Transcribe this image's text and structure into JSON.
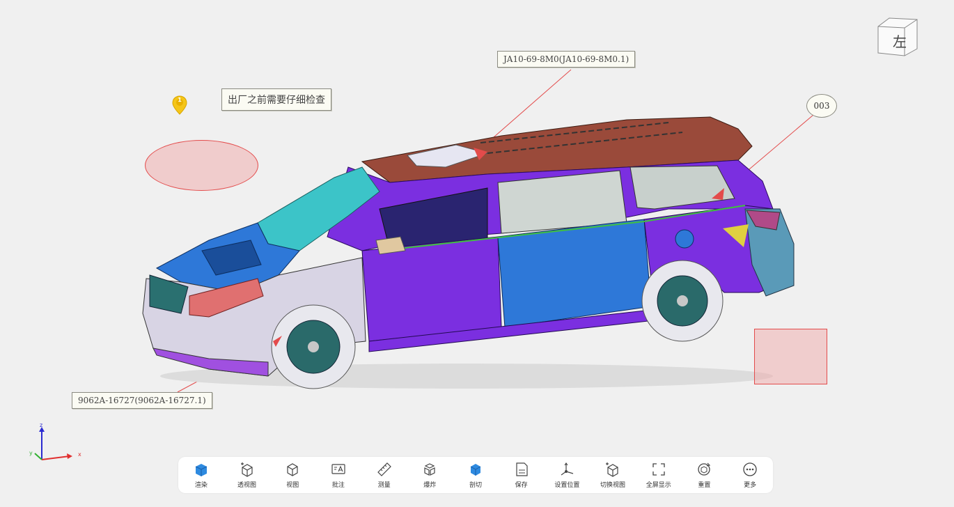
{
  "annotations": {
    "note_pin_number": "1",
    "note_text": "出厂之前需要仔细检查",
    "part_label_roof": "JA10-69-8M0(JA10-69-8M0.1)",
    "part_label_bumper": "9062A-16727(9062A-16727.1)",
    "circle_tag": "003"
  },
  "view_cube": {
    "face_label": "左"
  },
  "axes": {
    "x": "x",
    "y": "y",
    "z": "z"
  },
  "toolbar": {
    "items": [
      {
        "label": "渲染",
        "icon": "render-icon"
      },
      {
        "label": "透视图",
        "icon": "perspective-view-icon"
      },
      {
        "label": "视图",
        "icon": "view-icon"
      },
      {
        "label": "批注",
        "icon": "annotate-icon"
      },
      {
        "label": "测量",
        "icon": "ruler-icon"
      },
      {
        "label": "爆炸",
        "icon": "explode-icon"
      },
      {
        "label": "剖切",
        "icon": "section-cut-icon"
      },
      {
        "label": "保存",
        "icon": "save-icon"
      },
      {
        "label": "设置位置",
        "icon": "set-position-icon"
      },
      {
        "label": "切换视图",
        "icon": "switch-view-icon"
      },
      {
        "label": "全屏显示",
        "icon": "fullscreen-icon"
      },
      {
        "label": "重置",
        "icon": "reset-icon"
      },
      {
        "label": "更多",
        "icon": "more-icon"
      }
    ]
  },
  "colors": {
    "annotation_red": "#e34b4b",
    "body_purple": "#7b2fe0",
    "body_blue": "#2e78d8",
    "glass_cyan": "#3cc4c8",
    "roof_brown": "#9a4a3a"
  }
}
